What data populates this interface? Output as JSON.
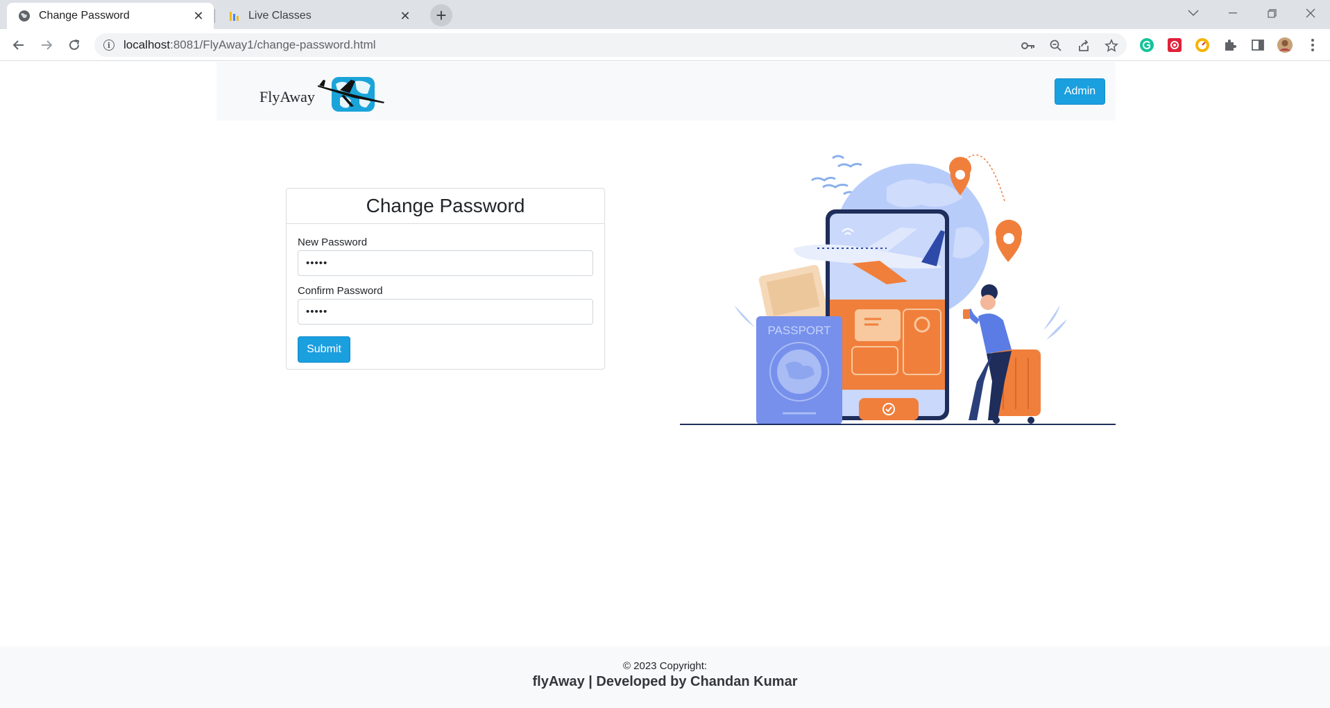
{
  "browser": {
    "tabs": [
      {
        "title": "Change Password",
        "active": true,
        "icon": "globe-icon"
      },
      {
        "title": "Live Classes",
        "active": false,
        "icon": "bar-chart-favicon-icon"
      }
    ],
    "new_tab_symbol": "+",
    "url": {
      "host": "localhost",
      "rest": ":8081/FlyAway1/change-password.html"
    }
  },
  "navbar": {
    "brand": "FlyAway",
    "admin_label": "Admin"
  },
  "form": {
    "title": "Change Password",
    "new_password_label": "New Password",
    "new_password_value": "•••••",
    "confirm_password_label": "Confirm Password",
    "confirm_password_value": "•••••",
    "submit_label": "Submit"
  },
  "illustration": {
    "passport_text": "PASSPORT",
    "colors": {
      "phone_orange": "#f07f3c",
      "globe_blue": "#b8ccfa",
      "passport_blue": "#7690ec",
      "dark_navy": "#1e2d5a"
    }
  },
  "footer": {
    "copyright": "© 2023 Copyright:",
    "developer": "flyAway | Developed by Chandan Kumar"
  },
  "colors": {
    "primary": "#1a9fdf",
    "navbar_bg": "#f8f9fa"
  }
}
